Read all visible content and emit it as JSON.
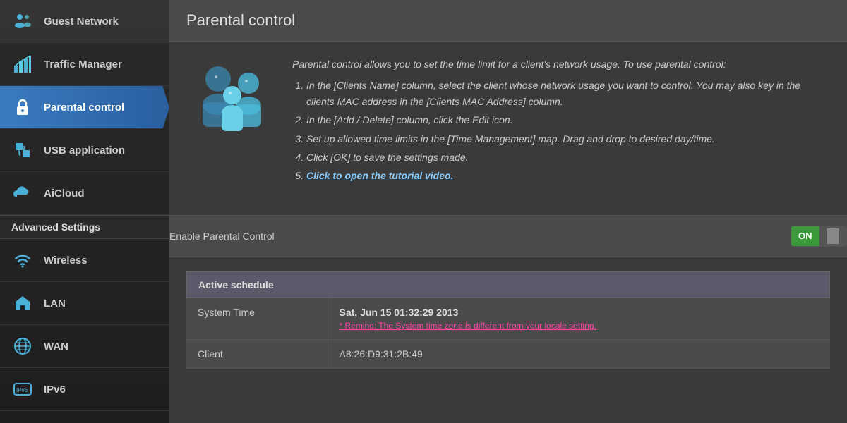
{
  "sidebar": {
    "items": [
      {
        "id": "guest-network",
        "label": "Guest Network",
        "icon": "people-icon"
      },
      {
        "id": "traffic-manager",
        "label": "Traffic Manager",
        "icon": "chart-icon"
      },
      {
        "id": "parental-control",
        "label": "Parental control",
        "icon": "lock-icon",
        "active": true
      },
      {
        "id": "usb-application",
        "label": "USB application",
        "icon": "puzzle-icon"
      },
      {
        "id": "aicloud",
        "label": "AiCloud",
        "icon": "cloud-icon"
      }
    ],
    "advanced_settings_label": "Advanced Settings",
    "advanced_items": [
      {
        "id": "wireless",
        "label": "Wireless",
        "icon": "wifi-icon"
      },
      {
        "id": "lan",
        "label": "LAN",
        "icon": "home-icon"
      },
      {
        "id": "wan",
        "label": "WAN",
        "icon": "globe-icon"
      },
      {
        "id": "ipv6",
        "label": "IPv6",
        "icon": "ipv6-icon"
      }
    ]
  },
  "main": {
    "page_title": "Parental control",
    "intro_text_1": "Parental control allows you to set the time limit for a client's network usage. To use parental control:",
    "steps": [
      "In the [Clients Name] column, select the client whose network usage you want to control. You may also key in the clients MAC address in the [Clients MAC Address] column.",
      "In the [Add / Delete] column, click the Edit icon.",
      "Set up allowed time limits in the [Time Management] map. Drag and drop to desired day/time.",
      "Click [OK] to save the settings made.",
      "Click to open the tutorial video."
    ],
    "tutorial_link_text": "Click to open the tutorial video.",
    "enable_label": "Enable Parental Control",
    "toggle_on_label": "ON",
    "schedule_section_title": "Active schedule",
    "table_rows": [
      {
        "label": "System Time",
        "value_main": "Sat, Jun 15  01:32:29  2013",
        "value_warning": "* Remind: The System time zone is different from your locale setting."
      },
      {
        "label": "Client",
        "value_main": "A8:26:D9:31:2B:49",
        "value_warning": ""
      }
    ]
  }
}
